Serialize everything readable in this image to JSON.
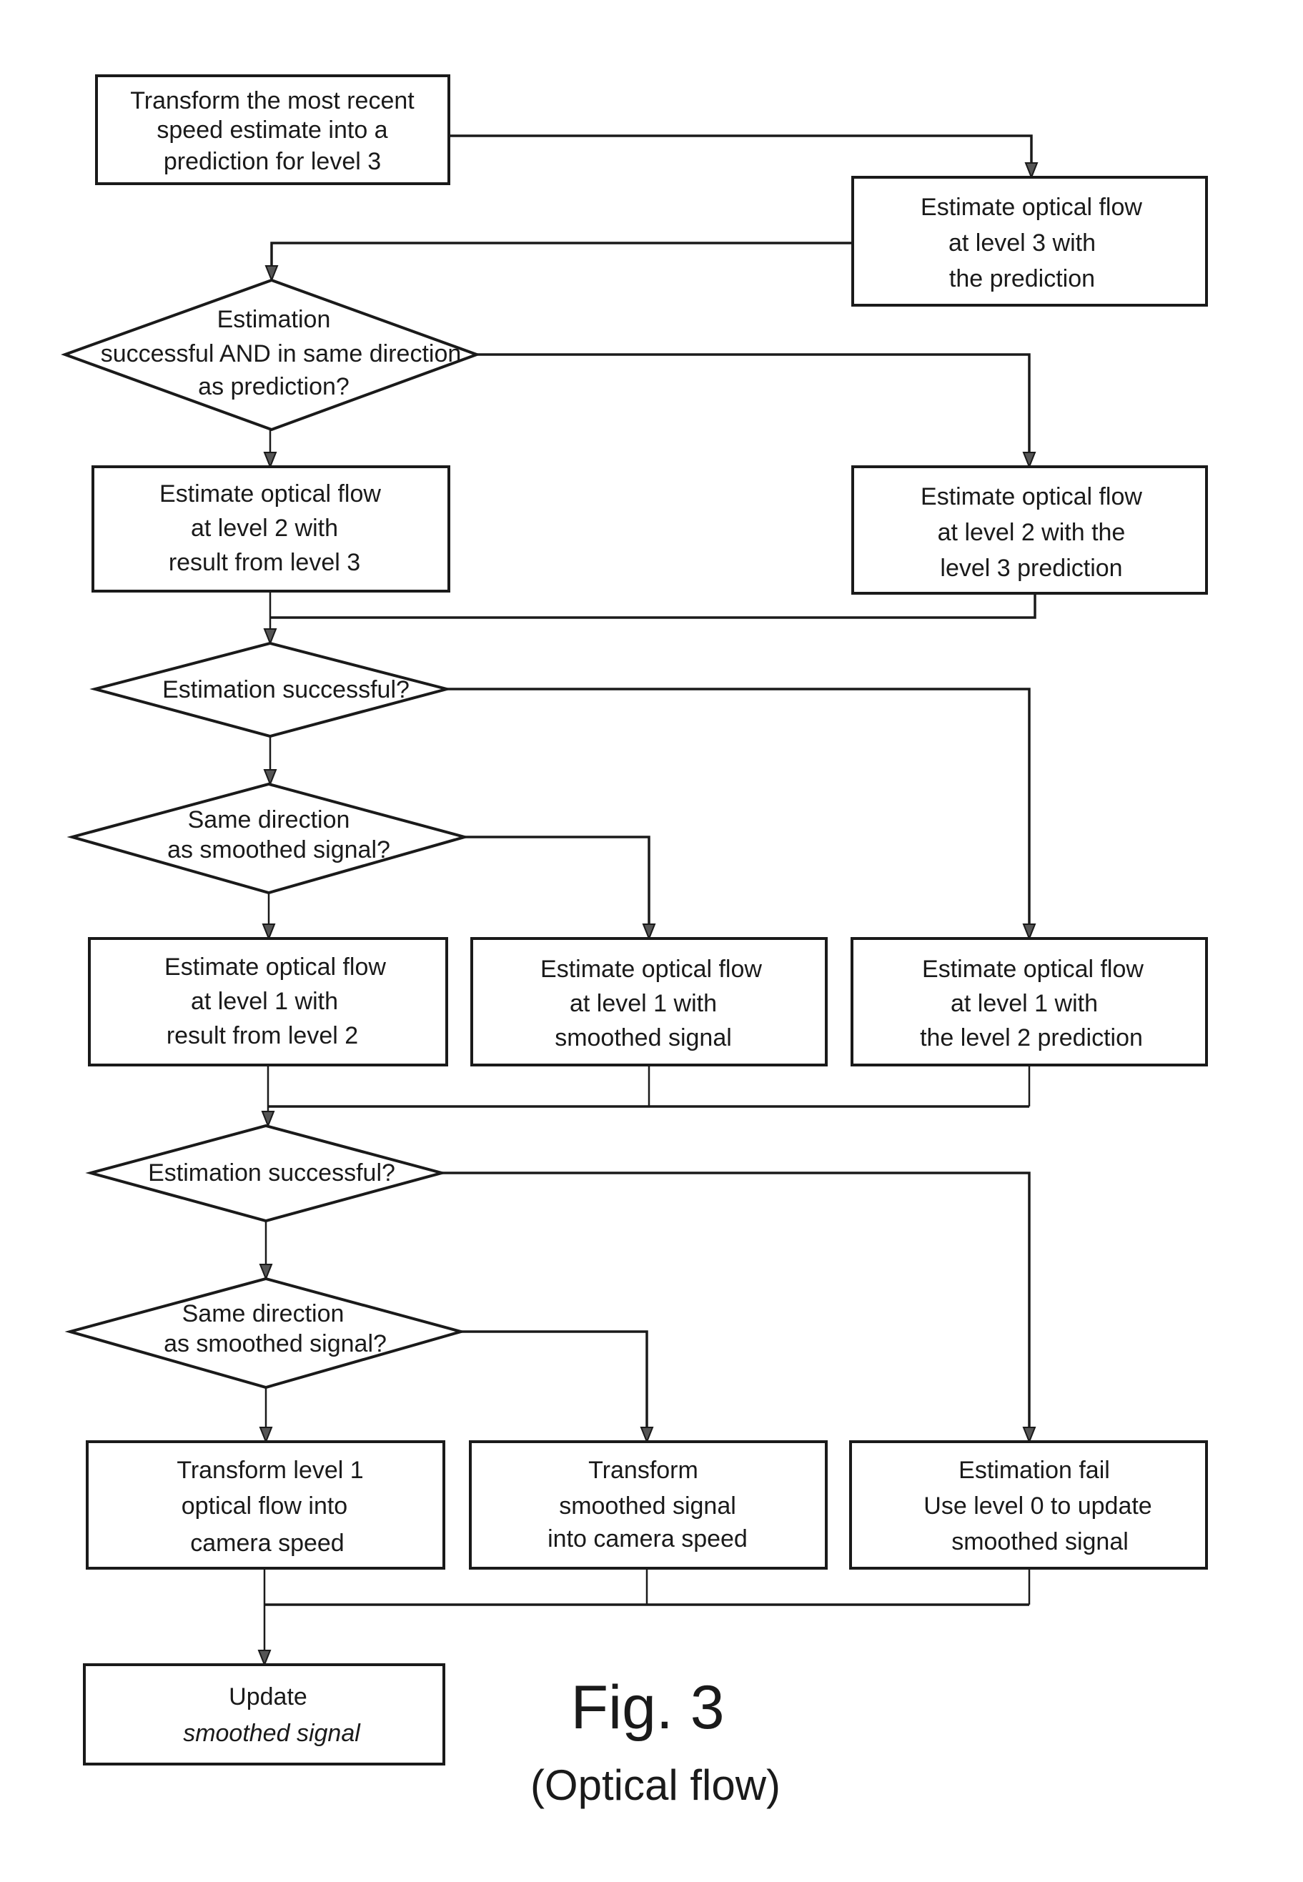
{
  "figure": {
    "title": "Fig. 3",
    "subtitle": "(Optical flow)"
  },
  "nodes": {
    "start": {
      "type": "process",
      "lines": [
        "Transform the most recent",
        "speed estimate into a",
        "prediction for level 3"
      ]
    },
    "est_l3": {
      "type": "process",
      "lines": [
        "Estimate optical flow",
        "at level 3 with",
        "the prediction"
      ]
    },
    "dec1": {
      "type": "decision",
      "lines": [
        "Estimation",
        "successful AND in same direction",
        "as prediction?"
      ]
    },
    "est_l2_result": {
      "type": "process",
      "lines": [
        "Estimate optical flow",
        "at level 2 with",
        "result from level 3"
      ]
    },
    "est_l2_pred": {
      "type": "process",
      "lines": [
        "Estimate optical flow",
        "at level 2 with the",
        "level 3 prediction"
      ]
    },
    "dec2": {
      "type": "decision",
      "lines": [
        "Estimation successful?"
      ]
    },
    "dec3": {
      "type": "decision",
      "lines": [
        "Same direction",
        "as smoothed signal?"
      ]
    },
    "est_l1_result": {
      "type": "process",
      "lines": [
        "Estimate optical flow",
        "at level 1 with",
        "result from level 2"
      ]
    },
    "est_l1_smooth": {
      "type": "process",
      "lines": [
        "Estimate optical flow",
        "at level 1 with",
        "smoothed signal"
      ]
    },
    "est_l1_pred": {
      "type": "process",
      "lines": [
        "Estimate optical flow",
        "at level 1 with",
        "the level 2 prediction"
      ]
    },
    "dec4": {
      "type": "decision",
      "lines": [
        "Estimation successful?"
      ]
    },
    "dec5": {
      "type": "decision",
      "lines": [
        "Same direction",
        "as smoothed signal?"
      ]
    },
    "transform_l1": {
      "type": "process",
      "lines": [
        "Transform level 1",
        "optical flow into",
        "camera speed"
      ]
    },
    "transform_smooth": {
      "type": "process",
      "lines": [
        "Transform",
        "smoothed signal",
        "into camera speed"
      ]
    },
    "fail": {
      "type": "process",
      "lines": [
        "Estimation fail",
        "Use level 0 to update",
        "smoothed signal"
      ]
    },
    "update": {
      "type": "process",
      "lines": [
        "Update",
        "smoothed signal"
      ]
    }
  },
  "edges": [
    [
      "start",
      "est_l3"
    ],
    [
      "est_l3",
      "dec1"
    ],
    [
      "dec1",
      "est_l2_result"
    ],
    [
      "dec1",
      "est_l2_pred"
    ],
    [
      "est_l2_result",
      "dec2"
    ],
    [
      "est_l2_pred",
      "dec2"
    ],
    [
      "dec2",
      "dec3"
    ],
    [
      "dec2",
      "est_l1_pred"
    ],
    [
      "dec3",
      "est_l1_result"
    ],
    [
      "dec3",
      "est_l1_smooth"
    ],
    [
      "est_l1_result",
      "dec4"
    ],
    [
      "est_l1_smooth",
      "dec4"
    ],
    [
      "est_l1_pred",
      "dec4"
    ],
    [
      "dec4",
      "dec5"
    ],
    [
      "dec4",
      "fail"
    ],
    [
      "dec5",
      "transform_l1"
    ],
    [
      "dec5",
      "transform_smooth"
    ],
    [
      "transform_l1",
      "update"
    ],
    [
      "transform_smooth",
      "update"
    ],
    [
      "fail",
      "update"
    ]
  ]
}
